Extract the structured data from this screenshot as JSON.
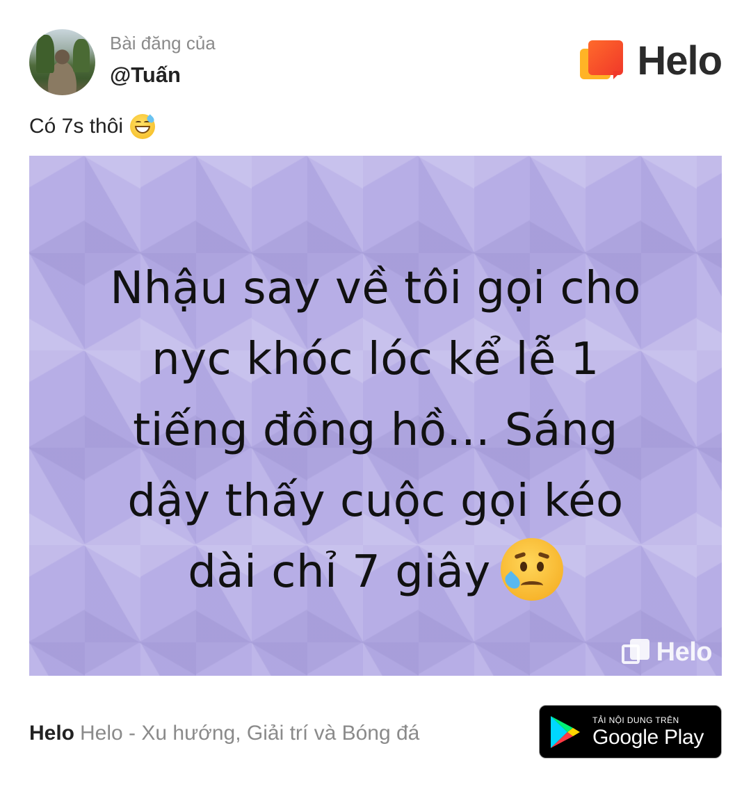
{
  "post": {
    "posted_by_label": "Bài đăng của",
    "username": "@Tuấn",
    "caption": "Có 7s thôi",
    "caption_emoji": "grinning-sweat-emoji"
  },
  "brand": {
    "name": "Helo",
    "accent_color": "#f0382a",
    "accent_color_2": "#ffb326"
  },
  "image": {
    "lines": [
      "Nhậu say về tôi gọi cho",
      "nyc khóc lóc kể lễ 1",
      "tiếng đồng hồ... Sáng",
      "dậy thấy cuộc gọi kéo",
      "dài chỉ 7 giây"
    ],
    "emoji": "crying-face-emoji",
    "background_color": "#b7aee6",
    "watermark": "Helo"
  },
  "footer": {
    "app_name": "Helo",
    "app_description": "Helo - Xu hướng, Giải trí và Bóng đá",
    "store_badge": {
      "small_text": "TẢI NỘI DUNG TRÊN",
      "big_text": "Google Play"
    }
  }
}
